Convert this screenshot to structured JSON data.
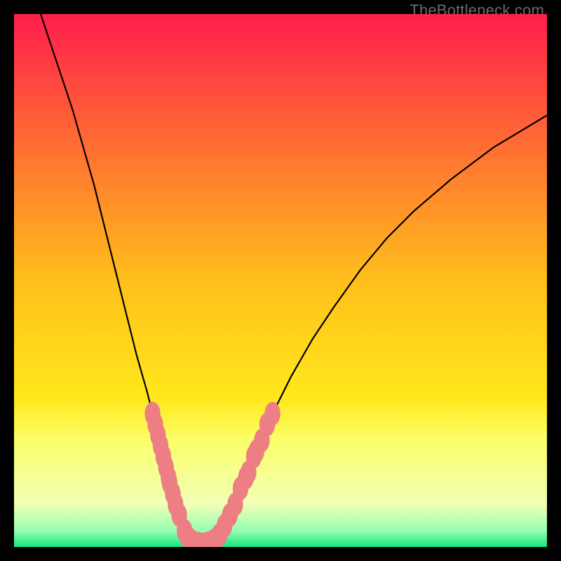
{
  "watermark": "TheBottleneck.com",
  "chart_data": {
    "type": "line",
    "title": "",
    "xlabel": "",
    "ylabel": "",
    "xlim": [
      0,
      100
    ],
    "ylim": [
      0,
      100
    ],
    "grid": false,
    "legend": false,
    "background_gradient": {
      "stops": [
        {
          "pct": 0.0,
          "color": "#ff1e4b"
        },
        {
          "pct": 0.5,
          "color": "#ffbf1b"
        },
        {
          "pct": 0.72,
          "color": "#ffe81b"
        },
        {
          "pct": 0.8,
          "color": "#fbff6a"
        },
        {
          "pct": 0.92,
          "color": "#f0ffb5"
        },
        {
          "pct": 0.97,
          "color": "#95ffb3"
        },
        {
          "pct": 1.0,
          "color": "#15e57a"
        }
      ]
    },
    "series": [
      {
        "name": "bottleneck-curve",
        "color": "#000000",
        "x": [
          5,
          7,
          9,
          11,
          13,
          15,
          17,
          19,
          21,
          23,
          25,
          27,
          28,
          29,
          30,
          31,
          32,
          33,
          34,
          35,
          36,
          37,
          38,
          39,
          40,
          42,
          44,
          46,
          48,
          52,
          56,
          60,
          65,
          70,
          75,
          82,
          90,
          100
        ],
        "y": [
          100,
          94,
          88,
          82,
          75,
          68,
          60,
          52,
          44,
          36,
          29,
          21,
          17,
          13,
          9,
          6,
          3,
          1.5,
          0.8,
          0.5,
          0.5,
          0.8,
          1.5,
          3,
          5,
          9,
          14,
          19,
          24,
          32,
          39,
          45,
          52,
          58,
          63,
          69,
          75,
          81
        ]
      }
    ],
    "markers": {
      "name": "data-points",
      "color": "#ec7e84",
      "radius": 1.4,
      "points": [
        {
          "x": 26,
          "y": 25
        },
        {
          "x": 26.5,
          "y": 23
        },
        {
          "x": 27,
          "y": 21
        },
        {
          "x": 27.5,
          "y": 19
        },
        {
          "x": 28,
          "y": 17
        },
        {
          "x": 28.5,
          "y": 15
        },
        {
          "x": 29,
          "y": 13
        },
        {
          "x": 29.2,
          "y": 12
        },
        {
          "x": 29.8,
          "y": 10
        },
        {
          "x": 30.3,
          "y": 8
        },
        {
          "x": 31,
          "y": 6
        },
        {
          "x": 32,
          "y": 3
        },
        {
          "x": 32.6,
          "y": 1.8
        },
        {
          "x": 33.5,
          "y": 1.0
        },
        {
          "x": 34.5,
          "y": 0.6
        },
        {
          "x": 35.5,
          "y": 0.5
        },
        {
          "x": 36.5,
          "y": 0.7
        },
        {
          "x": 37.5,
          "y": 1.2
        },
        {
          "x": 38.5,
          "y": 2.2
        },
        {
          "x": 39.5,
          "y": 4
        },
        {
          "x": 40.5,
          "y": 6
        },
        {
          "x": 41.5,
          "y": 8
        },
        {
          "x": 42.5,
          "y": 11
        },
        {
          "x": 43.5,
          "y": 13
        },
        {
          "x": 44,
          "y": 14
        },
        {
          "x": 45,
          "y": 17
        },
        {
          "x": 45.5,
          "y": 18
        },
        {
          "x": 46.5,
          "y": 20
        },
        {
          "x": 47.5,
          "y": 23
        },
        {
          "x": 48.5,
          "y": 25
        }
      ]
    },
    "annotations": []
  }
}
